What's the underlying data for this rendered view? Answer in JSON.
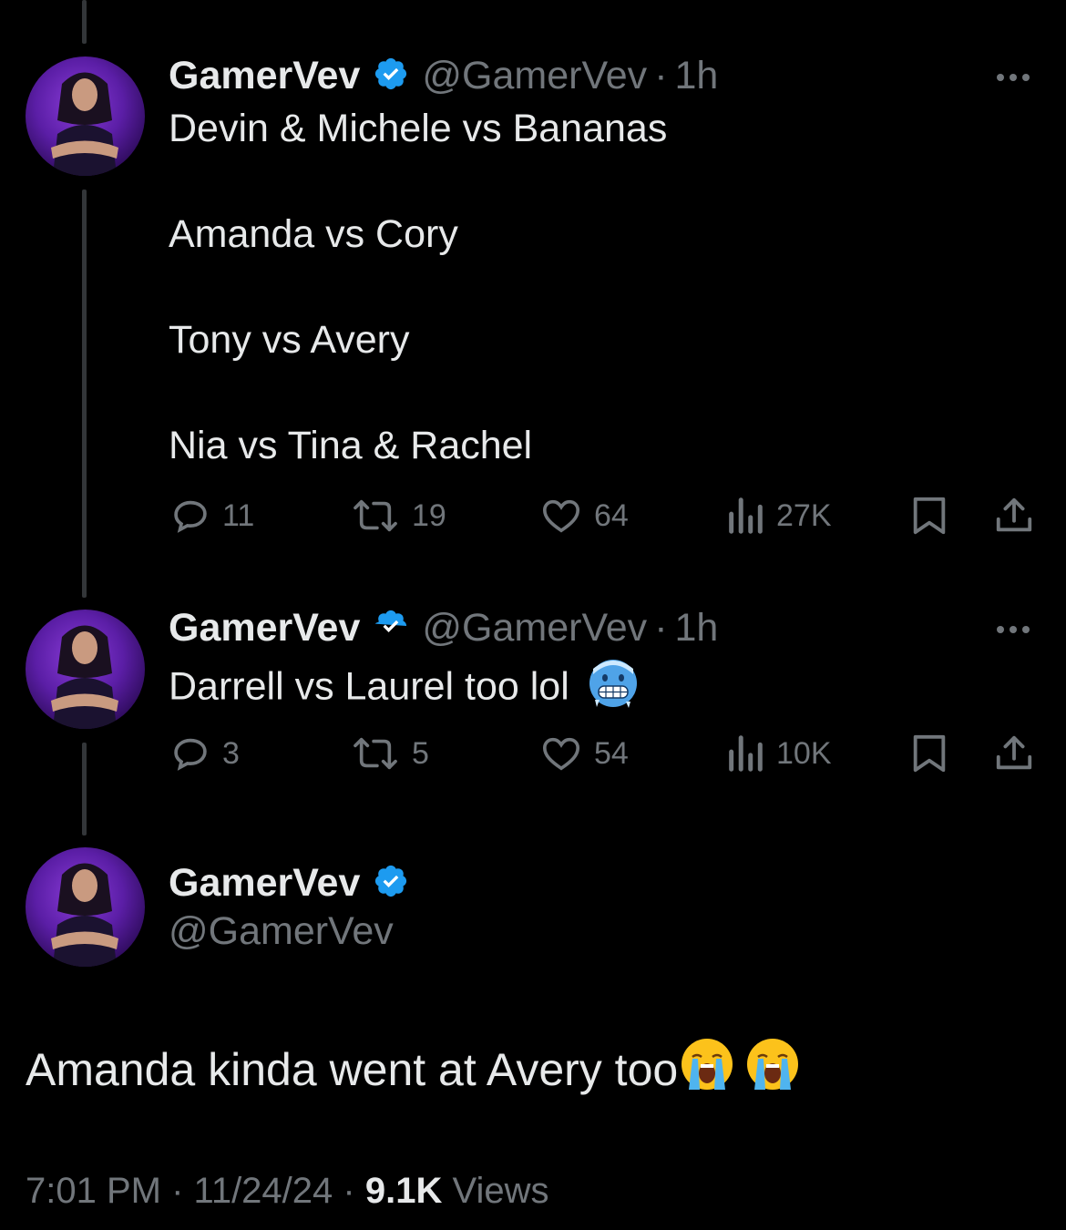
{
  "tweets": [
    {
      "name": "GamerVev",
      "handle": "@GamerVev",
      "sep": "·",
      "time": "1h",
      "lines": [
        "Devin & Michele vs Bananas",
        "Amanda vs Cory",
        "Tony vs Avery",
        "Nia vs Tina & Rachel"
      ],
      "replies": "11",
      "reposts": "19",
      "likes": "64",
      "views": "27K"
    },
    {
      "name": "GamerVev",
      "handle": "@GamerVev",
      "sep": "·",
      "time": "1h",
      "text": "Darrell vs Laurel too lol",
      "emoji": "cold-face-emoji",
      "replies": "3",
      "reposts": "5",
      "likes": "54",
      "views": "10K"
    }
  ],
  "focused": {
    "name": "GamerVev",
    "handle": "@GamerVev",
    "text": "Amanda kinda went at Avery too",
    "emojis": [
      "loudly-crying-face-emoji",
      "loudly-crying-face-emoji"
    ],
    "time": "7:01 PM",
    "sep1": "·",
    "date": "11/24/24",
    "sep2": "·",
    "views_count": "9.1K",
    "views_label": "Views"
  },
  "colors": {
    "background": "#000000",
    "text": "#e7e9ea",
    "muted": "#71767b",
    "verified": "#1d9bf0",
    "avatar_bg": "#5b1ea6"
  },
  "icons": [
    "reply-icon",
    "repost-icon",
    "like-icon",
    "views-icon",
    "bookmark-icon",
    "share-icon",
    "more-icon",
    "verified-badge-icon"
  ]
}
